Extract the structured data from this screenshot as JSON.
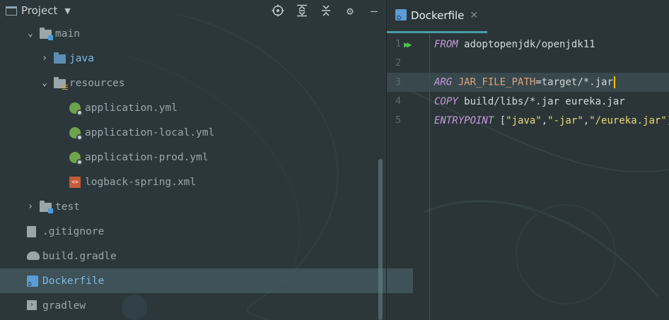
{
  "project_panel": {
    "title": "Project",
    "tree": [
      {
        "label": "main",
        "expanded": true
      },
      {
        "label": "java",
        "expanded": false
      },
      {
        "label": "resources",
        "expanded": true
      },
      {
        "label": "application.yml"
      },
      {
        "label": "application-local.yml"
      },
      {
        "label": "application-prod.yml"
      },
      {
        "label": "logback-spring.xml"
      },
      {
        "label": "test",
        "expanded": false
      },
      {
        "label": ".gitignore"
      },
      {
        "label": "build.gradle"
      },
      {
        "label": "Dockerfile",
        "selected": true
      },
      {
        "label": "gradlew"
      }
    ]
  },
  "editor": {
    "tab_label": "Dockerfile",
    "lines": [
      {
        "num": "1",
        "kw": "FROM",
        "rest": " adoptopenjdk/openjdk11"
      },
      {
        "num": "2",
        "kw": "",
        "rest": ""
      },
      {
        "num": "3",
        "kw": "ARG",
        "var": " JAR_FILE_PATH",
        "rest": "=target/*.jar"
      },
      {
        "num": "4",
        "kw": "COPY",
        "rest": " build/libs/*.jar eureka.jar"
      },
      {
        "num": "5",
        "kw": "ENTRYPOINT",
        "p1": " [",
        "s1": "\"java\"",
        "c1": ",",
        "s2": "\"-jar\"",
        "c2": ",",
        "s3": "\"/eureka.jar\"",
        "p2": "]"
      }
    ]
  },
  "colors": {
    "selection": "#465c62",
    "keyword": "#c49cd9",
    "variable": "#e0a37b",
    "string": "#e6db74",
    "tab_underline": "#4a9ca5",
    "run_icon": "#4fc24f"
  }
}
